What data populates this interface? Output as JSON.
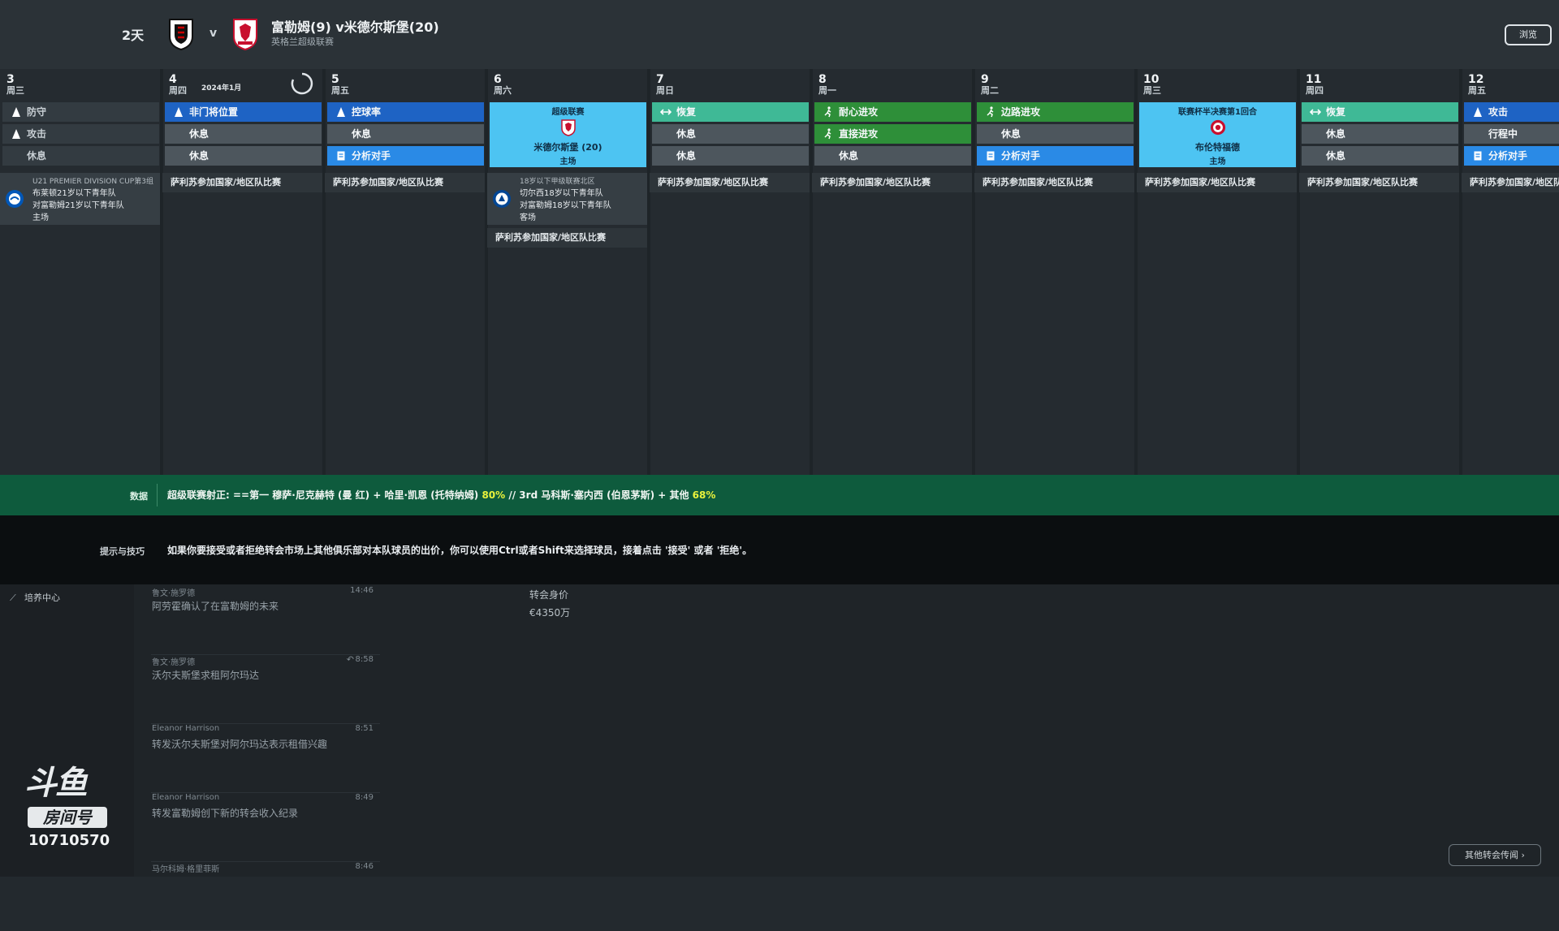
{
  "header": {
    "countdown": "2天",
    "vs": "v",
    "title": "富勒姆(9) v米德尔斯堡(20)",
    "competition": "英格兰超级联赛",
    "top_button": "浏览"
  },
  "calendar": {
    "month_label": "2024年1月",
    "days": [
      {
        "num": "3",
        "weekday": "周三",
        "sessions": [
          {
            "label": "防守",
            "style": "dark",
            "icon": "person"
          },
          {
            "label": "攻击",
            "style": "dark",
            "icon": "person"
          },
          {
            "label": "休息",
            "style": "dark",
            "icon": ""
          }
        ],
        "youth": {
          "comp": "U21 PREMIER DIVISION CUP第3组",
          "line1": "布莱顿21岁以下青年队",
          "line2": "对富勒姆21岁以下青年队",
          "venue": "主场"
        }
      },
      {
        "num": "4",
        "weekday": "周四",
        "sessions": [
          {
            "label": "非门将位置",
            "style": "blue",
            "icon": "person"
          },
          {
            "label": "休息",
            "style": "grey",
            "icon": ""
          },
          {
            "label": "休息",
            "style": "grey",
            "icon": ""
          }
        ],
        "intl": "萨利苏参加国家/地区队比赛"
      },
      {
        "num": "5",
        "weekday": "周五",
        "sessions": [
          {
            "label": "控球率",
            "style": "blue",
            "icon": "person"
          },
          {
            "label": "休息",
            "style": "grey",
            "icon": ""
          },
          {
            "label": "分析对手",
            "style": "lblue",
            "icon": "doc"
          }
        ],
        "intl": "萨利苏参加国家/地区队比赛"
      },
      {
        "num": "6",
        "weekday": "周六",
        "match": {
          "competition": "超级联赛",
          "opponent": "米德尔斯堡 (20)",
          "venue": "主场"
        },
        "youth": {
          "comp": "18岁以下甲级联赛北区",
          "line1": "切尔西18岁以下青年队",
          "line2": "对富勒姆18岁以下青年队",
          "venue": "客场"
        },
        "intl": "萨利苏参加国家/地区队比赛"
      },
      {
        "num": "7",
        "weekday": "周日",
        "sessions": [
          {
            "label": "恢复",
            "style": "teal",
            "icon": "recover"
          },
          {
            "label": "休息",
            "style": "grey",
            "icon": ""
          },
          {
            "label": "休息",
            "style": "grey",
            "icon": ""
          }
        ],
        "intl": "萨利苏参加国家/地区队比赛"
      },
      {
        "num": "8",
        "weekday": "周一",
        "sessions": [
          {
            "label": "耐心进攻",
            "style": "green",
            "icon": "run"
          },
          {
            "label": "直接进攻",
            "style": "green",
            "icon": "run"
          },
          {
            "label": "休息",
            "style": "grey",
            "icon": ""
          }
        ],
        "intl": "萨利苏参加国家/地区队比赛"
      },
      {
        "num": "9",
        "weekday": "周二",
        "sessions": [
          {
            "label": "边路进攻",
            "style": "green",
            "icon": "run"
          },
          {
            "label": "休息",
            "style": "grey",
            "icon": ""
          },
          {
            "label": "分析对手",
            "style": "lblue",
            "icon": "doc"
          }
        ],
        "intl": "萨利苏参加国家/地区队比赛"
      },
      {
        "num": "10",
        "weekday": "周三",
        "match": {
          "competition": "联赛杯半决赛第1回合",
          "opponent": "布伦特福德",
          "venue": "主场"
        },
        "intl": "萨利苏参加国家/地区队比赛"
      },
      {
        "num": "11",
        "weekday": "周四",
        "sessions": [
          {
            "label": "恢复",
            "style": "teal",
            "icon": "recover"
          },
          {
            "label": "休息",
            "style": "grey",
            "icon": ""
          },
          {
            "label": "休息",
            "style": "grey",
            "icon": ""
          }
        ],
        "intl": "萨利苏参加国家/地区队比赛"
      },
      {
        "num": "12",
        "weekday": "周五",
        "sessions": [
          {
            "label": "攻击",
            "style": "blue",
            "icon": "person"
          },
          {
            "label": "行程中",
            "style": "grey",
            "icon": ""
          },
          {
            "label": "分析对手",
            "style": "lblue",
            "icon": "doc"
          }
        ],
        "intl": "萨利苏参加国家/地区队比赛"
      }
    ]
  },
  "databar": {
    "label": "数据",
    "prefix": "超级联赛射正: ==第一 穆萨·尼克赫特 (曼 红) + 哈里·凯恩 (托特纳姆) ",
    "pct1": "80%",
    "middle": " // 3rd 马科斯·塞内西 (伯恩茅斯) + 其他 ",
    "pct2": "68%"
  },
  "tips": {
    "label": "提示与技巧",
    "text": "如果你要接受或者拒绝转会市场上其他俱乐部对本队球员的出价，你可以使用Ctrl或者Shift来选择球员，接着点击 '接受' 或者 '拒绝'。"
  },
  "nav": {
    "development": "培养中心"
  },
  "news": [
    {
      "source": "鲁文·施罗德",
      "time": "14:46",
      "headline": "阿劳霍确认了在富勒姆的未来",
      "replied": false
    },
    {
      "source": "鲁文·施罗德",
      "time": "8:58",
      "headline": "沃尔夫斯堡求租阿尔玛达",
      "replied": true
    },
    {
      "source": "Eleanor Harrison",
      "time": "8:51",
      "headline": "转发沃尔夫斯堡对阿尔玛达表示租借兴趣",
      "replied": false
    },
    {
      "source": "Eleanor Harrison",
      "time": "8:49",
      "headline": "转发富勒姆创下新的转会收入纪录",
      "replied": false
    },
    {
      "source": "马尔科姆·格里菲斯",
      "time": "8:46",
      "headline": "",
      "replied": false
    }
  ],
  "transfer": {
    "label": "转会身价",
    "value": "€4350万"
  },
  "more_button": "其他转会传闻",
  "watermark": {
    "logo": "斗鱼",
    "badge": "房间号",
    "room": "10710570"
  },
  "colors": {
    "data_bar": "#0e5b3d",
    "match_card": "#4dc4f2",
    "highlight": "#e8f23c"
  }
}
